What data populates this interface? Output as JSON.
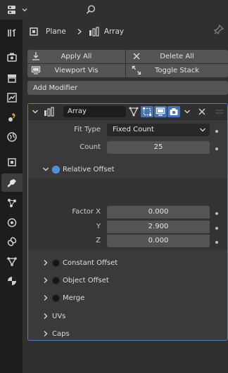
{
  "breadcrumb": {
    "object": "Plane",
    "modifier": "Array"
  },
  "toolbar": {
    "apply_all": "Apply All",
    "delete_all": "Delete All",
    "viewport_vis": "Viewport Vis",
    "toggle_stack": "Toggle Stack",
    "add_modifier": "Add Modifier"
  },
  "modifier": {
    "name": "Array",
    "fit_type_label": "Fit Type",
    "fit_type_value": "Fixed Count",
    "count_label": "Count",
    "count_value": "25",
    "relative_offset": {
      "label": "Relative Offset",
      "enabled": true,
      "factor_x_label": "Factor X",
      "y_label": "Y",
      "z_label": "Z",
      "x": "0.000",
      "y": "2.900",
      "z": "0.000"
    },
    "subpanels": [
      "Constant Offset",
      "Object Offset",
      "Merge",
      "UVs",
      "Caps"
    ]
  },
  "colors": {
    "accent": "#4b8fdc",
    "panel_border": "#4f83c2",
    "sidebar": "#1d1d1d"
  },
  "icons": [
    "editor-type-icon",
    "search-icon",
    "tool-icon",
    "render-icon",
    "output-icon",
    "view-layer-icon",
    "scene-icon",
    "world-icon",
    "object-icon",
    "modifier-icon",
    "particles-icon",
    "physics-icon",
    "constraints-icon",
    "data-icon",
    "material-icon",
    "pin-icon"
  ]
}
